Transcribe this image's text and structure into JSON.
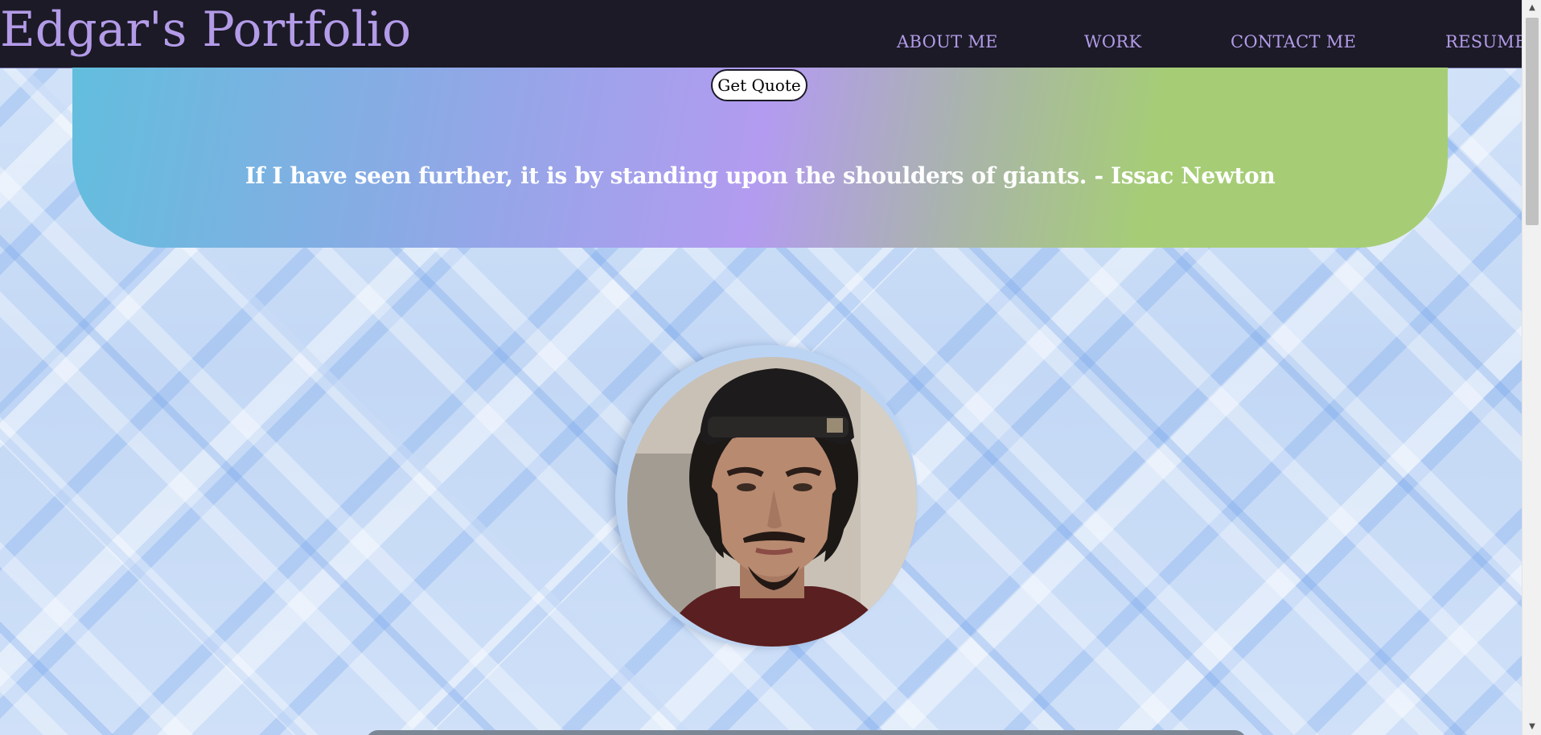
{
  "header": {
    "brand": "Edgar's Portfolio",
    "nav": [
      {
        "label": "ABOUT ME"
      },
      {
        "label": "WORK"
      },
      {
        "label": "CONTACT ME"
      },
      {
        "label": "RESUME"
      }
    ]
  },
  "quote": {
    "button_label": "Get Quote",
    "text": "If I have seen further, it is by standing upon the shoulders of giants. - Issac Newton"
  },
  "colors": {
    "nav_background": "#1b1a26",
    "accent": "#b39be8",
    "gradient": [
      "#62bedd",
      "#b39bf0",
      "#a6cd76"
    ]
  },
  "icons": {
    "profile": "profile-photo",
    "scroll_up": "chevron-up-icon",
    "scroll_down": "chevron-down-icon"
  }
}
